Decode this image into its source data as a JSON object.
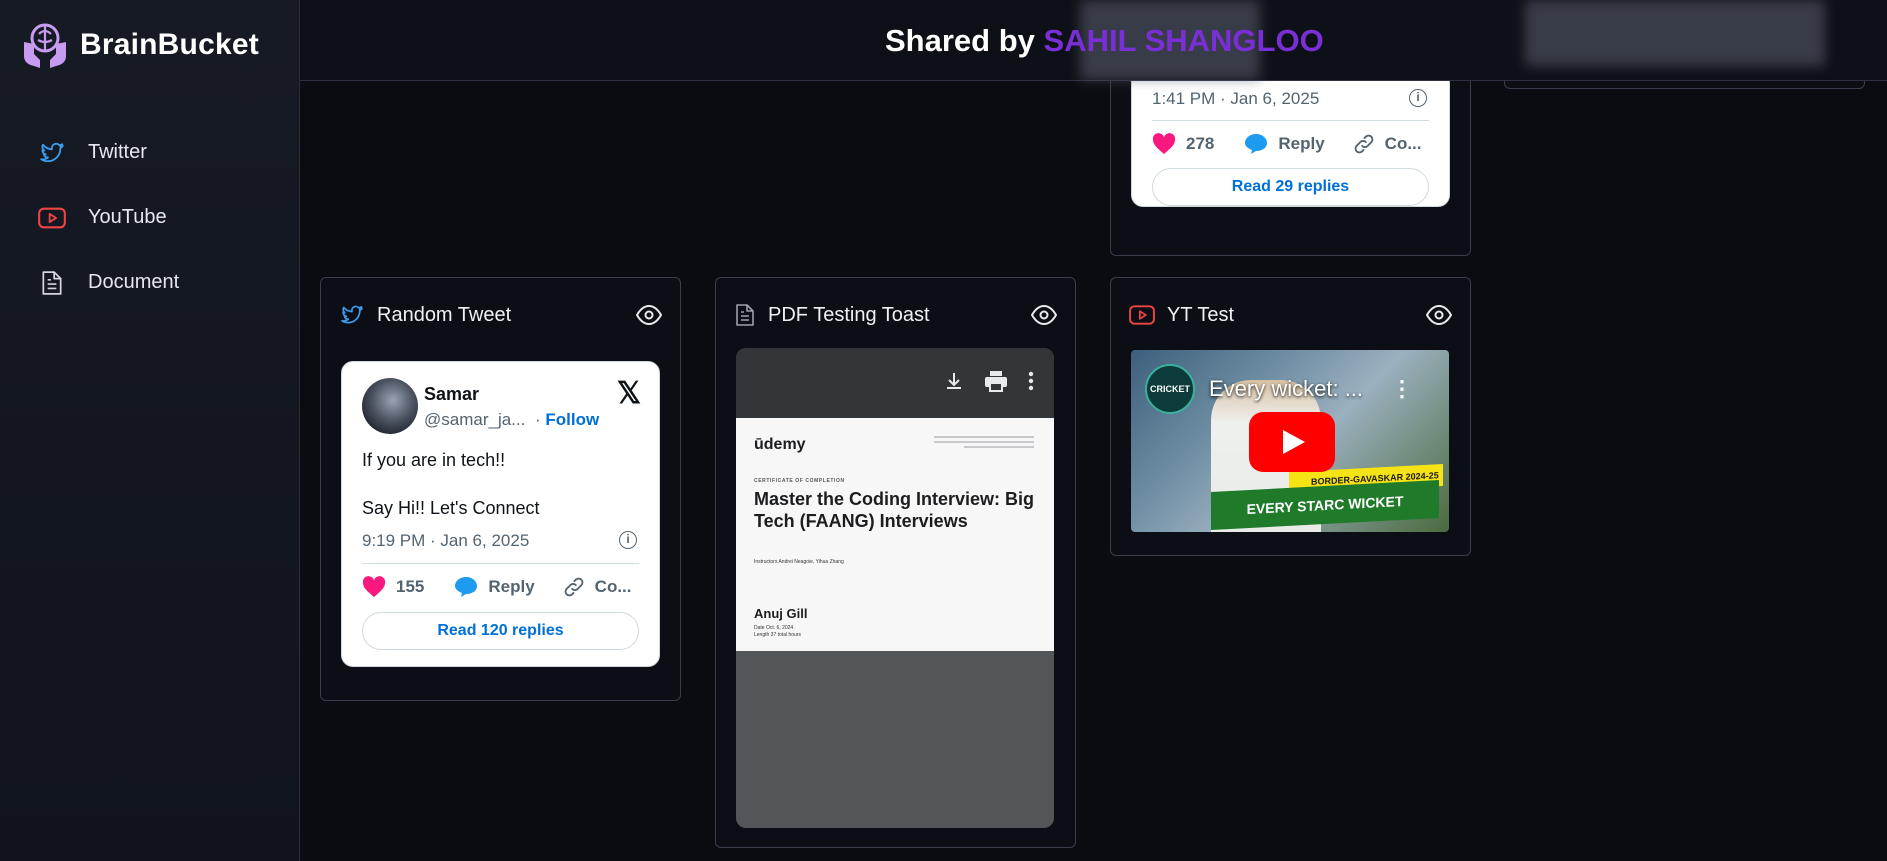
{
  "app": {
    "name": "BrainBucket"
  },
  "sidebar": {
    "items": [
      {
        "label": "Twitter",
        "icon": "twitter-icon"
      },
      {
        "label": "YouTube",
        "icon": "youtube-icon"
      },
      {
        "label": "Document",
        "icon": "document-icon"
      }
    ]
  },
  "header": {
    "prefix": "Shared by",
    "owner": "SAHIL SHANGLOO"
  },
  "top_tweet": {
    "time": "1:41 PM · Jan 6, 2025",
    "likes": "278",
    "reply_label": "Reply",
    "copy_label": "Co...",
    "read_label": "Read 29 replies"
  },
  "cards": {
    "tweet": {
      "title": "Random Tweet",
      "author_name": "Samar",
      "author_handle": "@samar_ja...",
      "follow_sep": "·",
      "follow_label": "Follow",
      "x_logo": "𝕏",
      "line1": "If you are in tech!!",
      "line2": "Say Hi!! Let's Connect",
      "time": "9:19 PM · Jan 6, 2025",
      "likes": "155",
      "reply_label": "Reply",
      "copy_label": "Co...",
      "read_label": "Read 120 replies"
    },
    "pdf": {
      "title": "PDF Testing Toast",
      "brand": "ūdemy",
      "cert_label": "CERTIFICATE OF COMPLETION",
      "course": "Master the Coding Interview: Big Tech (FAANG) Interviews",
      "instructors": "Instructors  Andrei Neagoie,  Yihua Zhang",
      "learner": "Anuj Gill",
      "date": "Date  Oct. 6, 2024",
      "length": "Length  37 total hours"
    },
    "video": {
      "title": "YT Test",
      "video_title": "Every wicket: ...",
      "channel_badge": "CRICKET",
      "banner_top": "BORDER-GAVASKAR 2024-25",
      "banner_bottom": "EVERY STARC WICKET"
    }
  },
  "colors": {
    "accent": "#7a2fd6",
    "like": "#f91880",
    "link": "#006fd6",
    "twitter": "#1d9bf0",
    "youtube": "#ef4444"
  }
}
